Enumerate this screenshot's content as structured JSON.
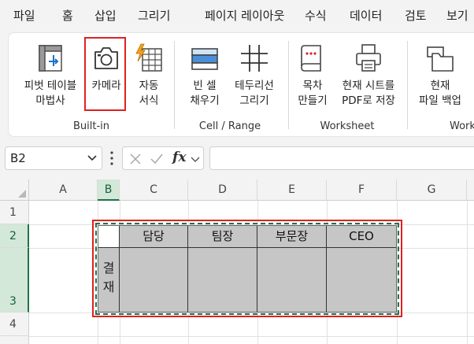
{
  "menu": [
    {
      "label": "파일",
      "name": "menu-file"
    },
    {
      "label": "홈",
      "name": "menu-home"
    },
    {
      "label": "삽입",
      "name": "menu-insert"
    },
    {
      "label": "그리기",
      "name": "menu-draw"
    },
    {
      "label": "페이지 레이아웃",
      "name": "menu-page-layout"
    },
    {
      "label": "수식",
      "name": "menu-formulas"
    },
    {
      "label": "데이터",
      "name": "menu-data"
    },
    {
      "label": "검토",
      "name": "menu-review"
    },
    {
      "label": "보기",
      "name": "menu-view"
    }
  ],
  "ribbon": {
    "builtin": {
      "pivot": "피벗 테이블\n마법사",
      "camera": "카메라",
      "autoformat": "자동\n서식",
      "group": "Built-in"
    },
    "cellrange": {
      "fill_empty": "빈 셀\n채우기",
      "draw_borders": "테두리선\n그리기",
      "group": "Cell / Range"
    },
    "worksheet": {
      "toc": "목차\n만들기",
      "save_pdf": "현재 시트를\nPDF로 저장",
      "group": "Worksheet"
    },
    "workbook": {
      "backup": "현재\n파일 백업",
      "group": "Work"
    }
  },
  "formula_bar": {
    "name_box": "B2",
    "fx": "fx",
    "value": ""
  },
  "columns": [
    "A",
    "B",
    "C",
    "D",
    "E",
    "F",
    "G"
  ],
  "selected_column": "B",
  "rows": [
    "1",
    "2",
    "3",
    "4"
  ],
  "selected_rows": [
    "2",
    "3"
  ],
  "approval_table": {
    "headers": [
      "담당",
      "팀장",
      "부문장",
      "CEO"
    ],
    "side_label": "결\n재"
  },
  "colors": {
    "accent": "#217346",
    "highlight": "#e02020",
    "table_fill": "#c6c6c6"
  }
}
